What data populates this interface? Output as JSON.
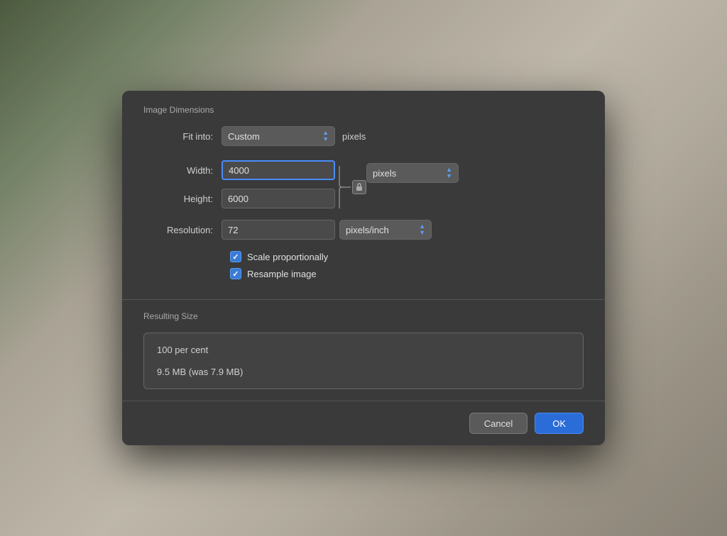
{
  "background": {
    "color1": "#4a5a3a",
    "color2": "#8a9a7a"
  },
  "dialog": {
    "sections": {
      "image_dimensions": {
        "title": "Image Dimensions",
        "fit_into_label": "Fit into:",
        "fit_into_value": "Custom",
        "fit_into_unit": "pixels",
        "width_label": "Width:",
        "width_value": "4000",
        "height_label": "Height:",
        "height_value": "6000",
        "resolution_label": "Resolution:",
        "resolution_value": "72",
        "unit_pixels": "pixels",
        "unit_pixels_inch": "pixels/inch",
        "scale_proportionally_label": "Scale proportionally",
        "resample_image_label": "Resample image"
      },
      "resulting_size": {
        "title": "Resulting Size",
        "percent": "100 per cent",
        "size": "9.5 MB (was 7.9 MB)"
      }
    },
    "footer": {
      "cancel_label": "Cancel",
      "ok_label": "OK"
    }
  }
}
